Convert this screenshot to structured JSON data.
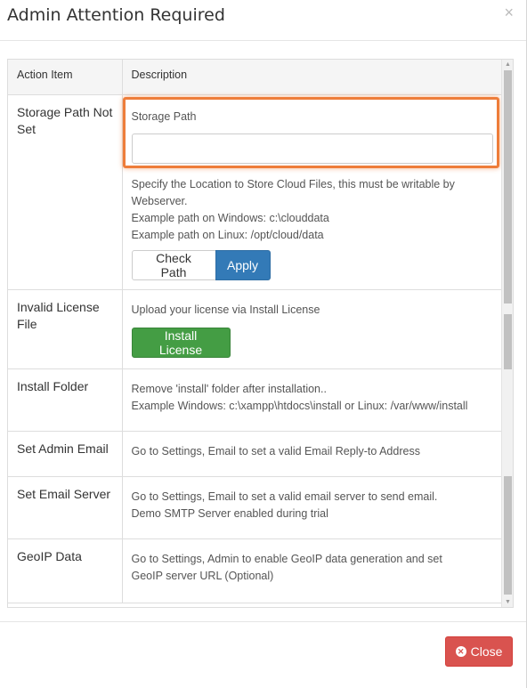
{
  "modal": {
    "title": "Admin Attention Required",
    "close_glyph": "×"
  },
  "table": {
    "headers": [
      "Action Item",
      "Description"
    ],
    "rows": [
      {
        "action": "Storage Path Not Set",
        "field_label": "Storage Path",
        "input_value": "",
        "hint_lines": [
          "Specify the Location to Store Cloud Files, this must be writable by Webserver.",
          "Example path on Windows: c:\\clouddata",
          "Example path on Linux: /opt/cloud/data"
        ],
        "buttons": [
          "Check Path",
          "Apply"
        ]
      },
      {
        "action": "Invalid License File",
        "desc_lines": [
          "Upload your license via Install License"
        ],
        "button": "Install License"
      },
      {
        "action": "Install Folder",
        "desc_lines": [
          "Remove 'install' folder after installation..",
          "Example Windows: c:\\xampp\\htdocs\\install or Linux: /var/www/install"
        ]
      },
      {
        "action": "Set Admin Email",
        "desc_lines": [
          "Go to Settings, Email to set a valid Email Reply-to Address"
        ]
      },
      {
        "action": "Set Email Server",
        "desc_lines": [
          "Go to Settings, Email to set a valid email server to send email.",
          "Demo SMTP Server enabled during trial"
        ]
      },
      {
        "action": "GeoIP Data",
        "desc_lines": [
          "Go to Settings, Admin to enable GeoIP data generation and set",
          "GeoIP server URL (Optional)"
        ]
      }
    ]
  },
  "footer": {
    "close_label": "Close"
  },
  "colors": {
    "highlight": "#ee7d3a",
    "primary": "#337ab7",
    "success": "#449d44",
    "danger": "#d9534f"
  },
  "icons": {
    "close": "close-icon",
    "close_button_icon": "times-circle-icon",
    "scroll_up": "scroll-up-arrow-icon",
    "scroll_down": "scroll-down-arrow-icon"
  }
}
